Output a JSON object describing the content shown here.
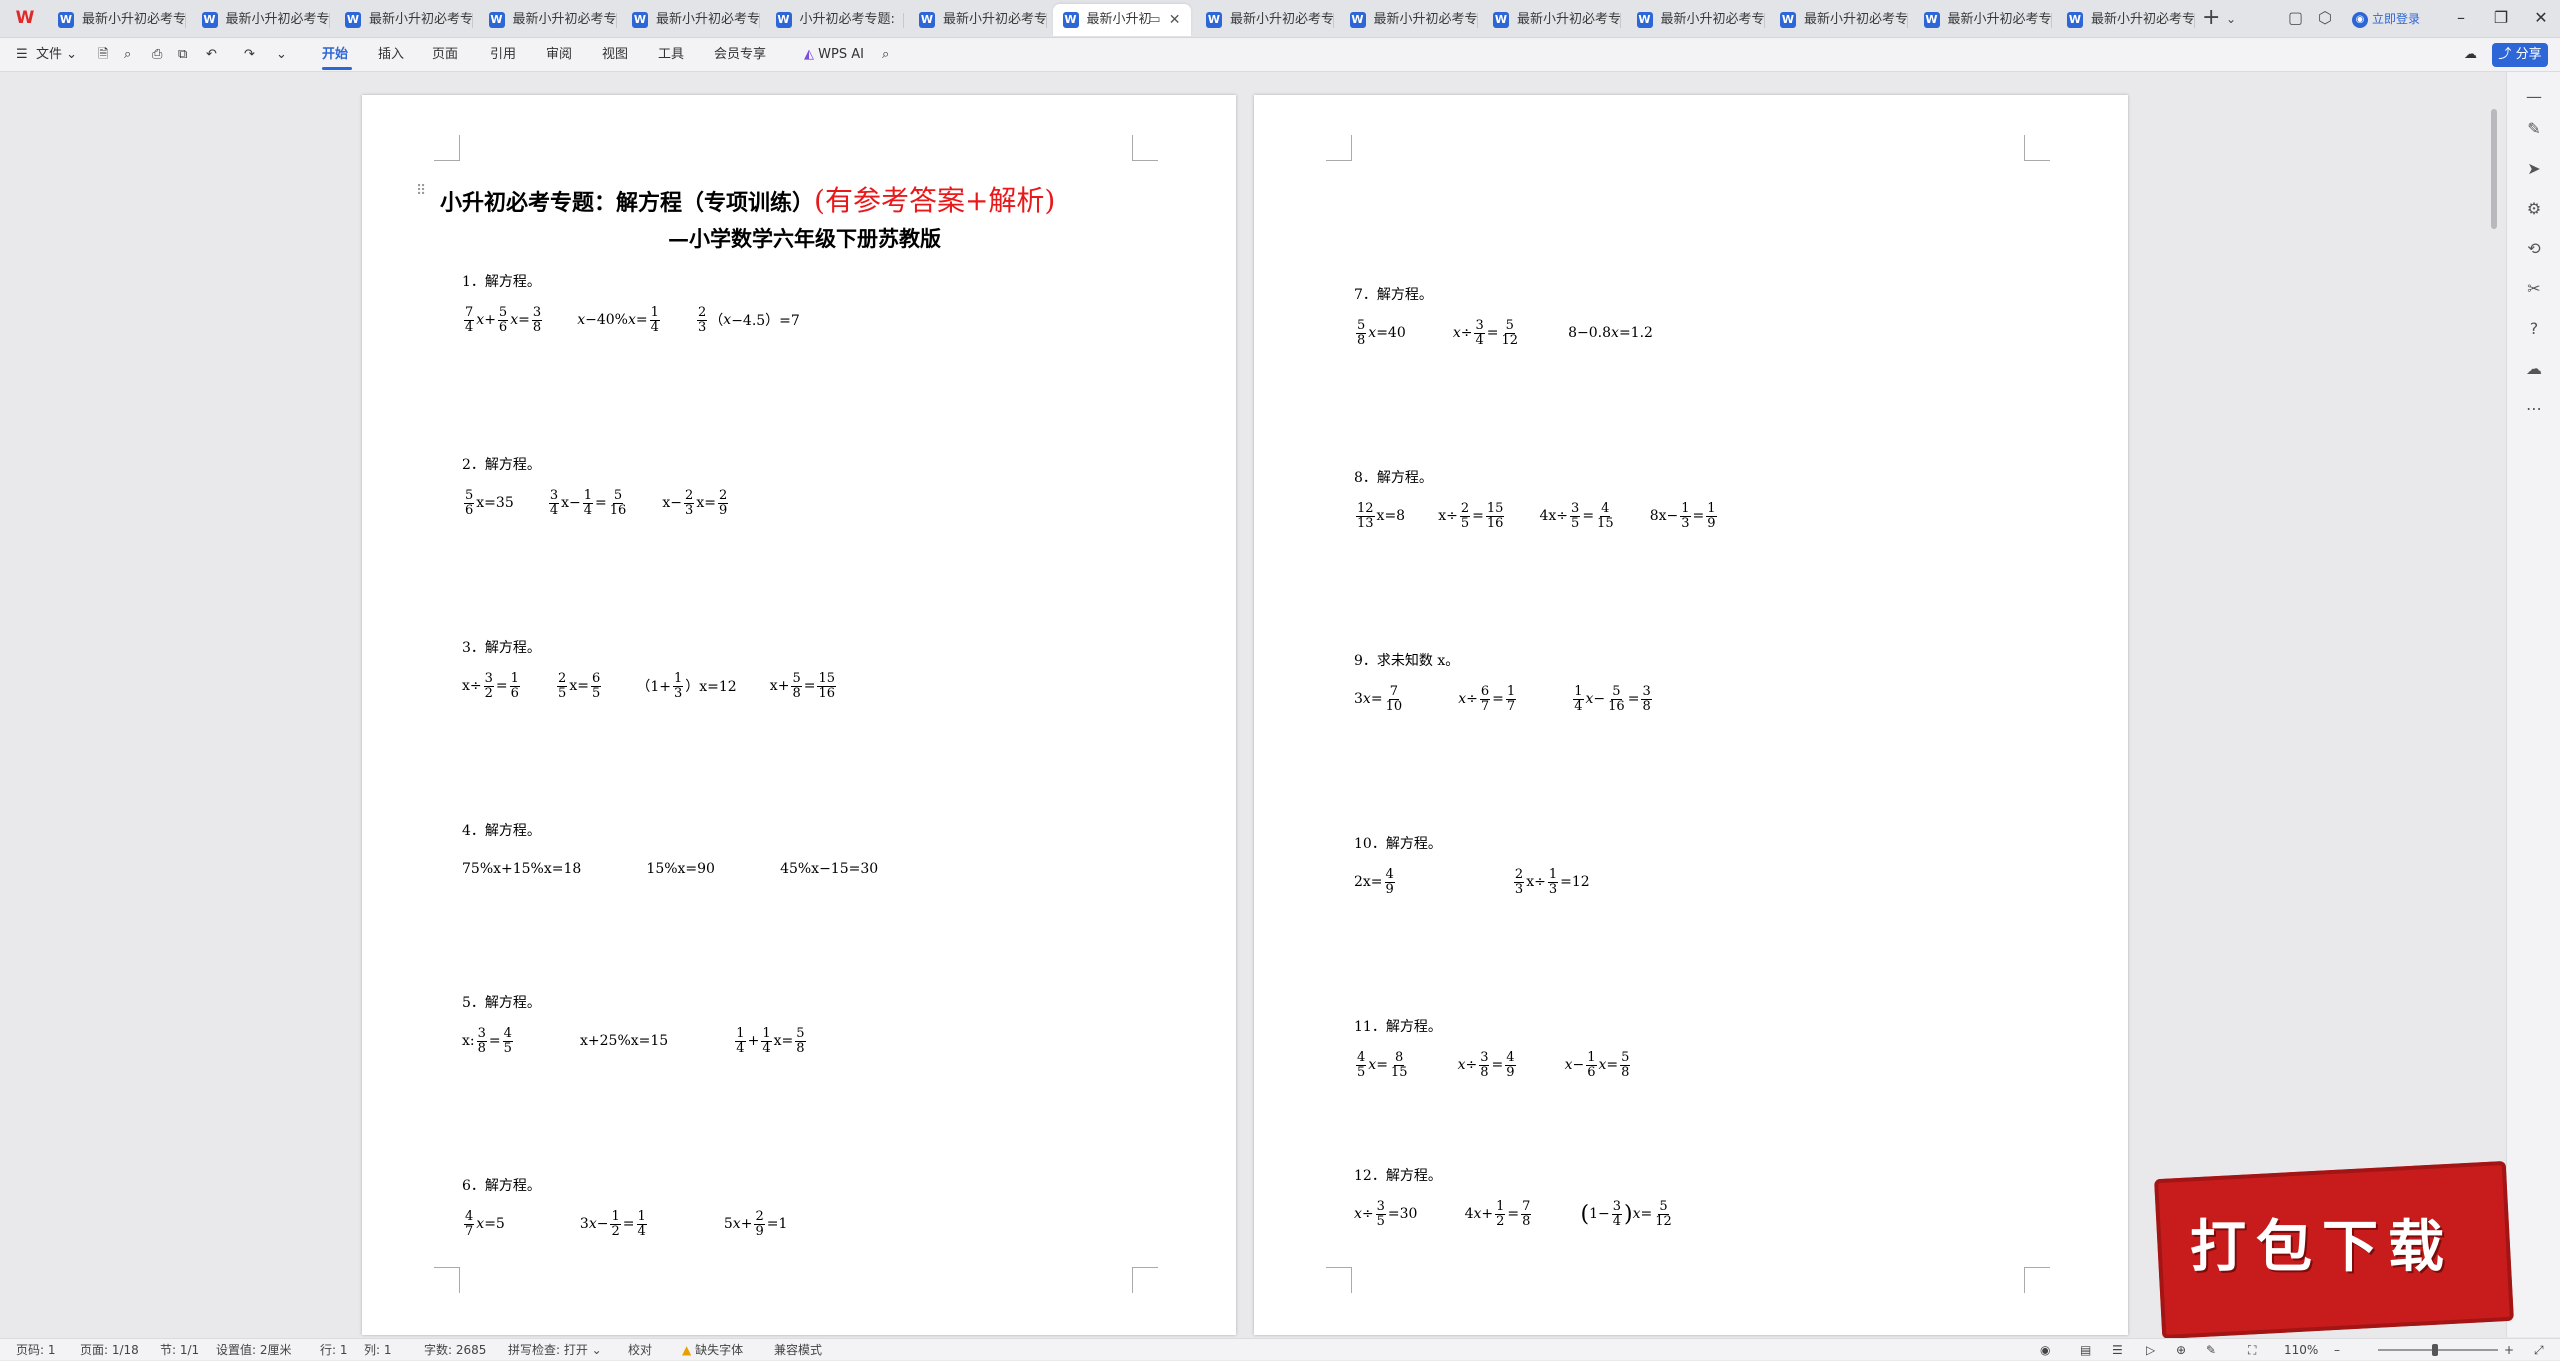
{
  "tabs": [
    "最新小升初必考专",
    "最新小升初必考专",
    "最新小升初必考专",
    "最新小升初必考专",
    "最新小升初必考专",
    "小升初必考专题:",
    "最新小升初必考专",
    "最新小升初",
    "最新小升初必考专",
    "最新小升初必考专",
    "最新小升初必考专",
    "最新小升初必考专",
    "最新小升初必考专",
    "最新小升初必考专",
    "最新小升初必考专"
  ],
  "login_label": "立即登录",
  "ribbon": {
    "file_label": "文件",
    "tabs": [
      "开始",
      "插入",
      "页面",
      "引用",
      "审阅",
      "视图",
      "工具",
      "会员专享"
    ],
    "wps_ai_label": "WPS AI",
    "share_label": "分享"
  },
  "document": {
    "title": "小升初必考专题：解方程（专项训练）",
    "title_highlight": "(有参考答案+解析)",
    "subtitle": "—小学数学六年级下册苏教版",
    "left_problems": [
      {
        "label": "1．解方程。"
      },
      {
        "label": "2．解方程。"
      },
      {
        "label": "3．解方程。"
      },
      {
        "label": "4．解方程。",
        "equations": [
          "75%x+15%x=18",
          "15%x=90",
          "45%x−15=30"
        ]
      },
      {
        "label": "5．解方程。"
      },
      {
        "label": "6．解方程。"
      }
    ],
    "right_problems": [
      {
        "label": "7．解方程。"
      },
      {
        "label": "8．解方程。"
      },
      {
        "label": "9．求未知数 x。"
      },
      {
        "label": "10．解方程。"
      },
      {
        "label": "11．解方程。"
      },
      {
        "label": "12．解方程。"
      }
    ]
  },
  "badge_text": "打包下载",
  "status": {
    "page_code": "页码: 1",
    "page": "页面: 1/18",
    "section": "节: 1/1",
    "settings": "设置值: 2厘米",
    "row": "行: 1",
    "col": "列: 1",
    "words": "字数: 2685",
    "spellcheck": "拼写检查: 打开",
    "proofread": "校对",
    "missing_font": "缺失字体",
    "compat": "兼容模式",
    "zoom": "110%"
  }
}
